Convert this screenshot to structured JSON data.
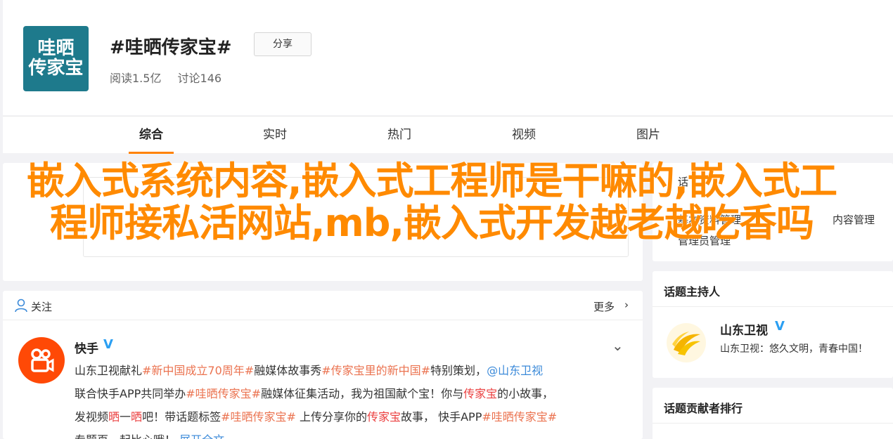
{
  "header": {
    "logo_line1": "哇晒",
    "logo_line2": "传家宝",
    "title": "#哇晒传家宝#",
    "share_label": "分享",
    "reads": "阅读1.5亿",
    "comments": "讨论146"
  },
  "tabs": [
    {
      "label": "综合",
      "active": true
    },
    {
      "label": "实时",
      "active": false
    },
    {
      "label": "热门",
      "active": false
    },
    {
      "label": "视频",
      "active": false
    },
    {
      "label": "图片",
      "active": false
    }
  ],
  "overlay": {
    "title": "嵌入式系统内容,嵌入式工程师是干嘛的,嵌入式工程师接私活网站,mb,嵌入式开发越老越吃香吗"
  },
  "side_partial": {
    "label_a": "基本资料管理",
    "label_b": "内容管理",
    "label_c": "管理员管理",
    "top_fragment": "话"
  },
  "follow": {
    "label": "关注",
    "more": "更多",
    "author": "快手",
    "lines": [
      [
        {
          "t": "山东卫视献礼",
          "c": ""
        },
        {
          "t": "#新中国成立70周年#",
          "c": "tag"
        },
        {
          "t": "融媒体故事秀",
          "c": ""
        },
        {
          "t": "#传家宝里的新中国#",
          "c": "tag"
        },
        {
          "t": "特别策划，",
          "c": ""
        },
        {
          "t": "@山东卫视",
          "c": "mention"
        }
      ],
      [
        {
          "t": "联合快手APP共同举办",
          "c": ""
        },
        {
          "t": "#哇晒传家宝#",
          "c": "tag"
        },
        {
          "t": "融媒体征集活动，我为祖国献个宝！你与",
          "c": ""
        },
        {
          "t": "传家宝",
          "c": "hl"
        },
        {
          "t": "的小故事，",
          "c": ""
        }
      ],
      [
        {
          "t": "发视频",
          "c": ""
        },
        {
          "t": "晒",
          "c": "hl"
        },
        {
          "t": "一",
          "c": ""
        },
        {
          "t": "晒",
          "c": "hl"
        },
        {
          "t": "吧！带话题标签",
          "c": ""
        },
        {
          "t": "#哇晒传家宝#",
          "c": "tag"
        },
        {
          "t": " 上传分享你的",
          "c": ""
        },
        {
          "t": "传家宝",
          "c": "hl"
        },
        {
          "t": "故事，  快手APP",
          "c": ""
        },
        {
          "t": "#哇晒传家宝#",
          "c": "tag"
        }
      ],
      [
        {
          "t": "专题页一起比心哦！ ",
          "c": ""
        },
        {
          "t": "展开全文",
          "c": "mention"
        }
      ]
    ]
  },
  "host": {
    "section_title": "话题主持人",
    "name": "山东卫视",
    "desc": "山东卫视：悠久文明，青春中国！"
  },
  "ranking": {
    "section_title": "话题贡献者排行"
  },
  "colors": {
    "accent": "#ff8200",
    "overlay_text": "#ff8a00",
    "tag": "#eb7350",
    "mention": "#3b8ad9",
    "verified": "#2b9ff2"
  }
}
